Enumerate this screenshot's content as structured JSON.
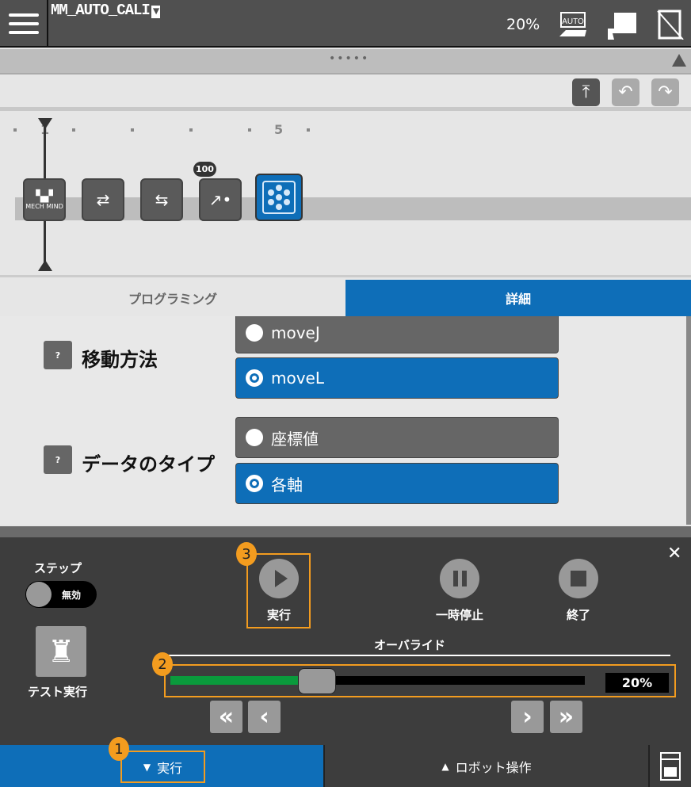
{
  "header": {
    "program_name": "MM_AUTO_CALI",
    "dropdown_glyph": "▼",
    "override": "20%",
    "icons": [
      "menu-icon",
      "auto-mode-icon",
      "robot-teach-icon",
      "tablet-disabled-icon"
    ]
  },
  "bar": {
    "handle": "•••••",
    "collapse": "▲"
  },
  "toolbar": {
    "icons": [
      "upload-icon",
      "undo-icon",
      "redo-icon"
    ]
  },
  "timeline": {
    "ruler_labels": {
      "first": "1",
      "fifth": "5"
    },
    "nodes": [
      {
        "name": "mech-mind-node",
        "label": "MECH MIND"
      },
      {
        "name": "coordinate-swap-node"
      },
      {
        "name": "tool-swap-node"
      },
      {
        "name": "move-node",
        "badge": "100"
      },
      {
        "name": "pattern-node",
        "selected": true
      }
    ]
  },
  "tabs": {
    "programming": "プログラミング",
    "details": "詳細"
  },
  "detail": {
    "help": "?",
    "move_method": {
      "label": "移動方法",
      "options": [
        "moveJ",
        "moveL"
      ],
      "selected": "moveL"
    },
    "data_type": {
      "label": "データのタイプ",
      "options": [
        "座標値",
        "各軸"
      ],
      "selected": "各軸"
    }
  },
  "panel": {
    "step_label": "ステップ",
    "step_toggle": "無効",
    "test_run": "テスト実行",
    "run": "実行",
    "pause": "一時停止",
    "stop": "終了",
    "override_label": "オーバライド",
    "override_value": "20%",
    "override_percent": 20,
    "badges": [
      "1",
      "2",
      "3"
    ],
    "nav": [
      "«",
      "‹",
      "›",
      "»"
    ]
  },
  "bottombar": {
    "run_tab": "実行",
    "run_arrow": "▼",
    "robot_tab": "ロボット操作",
    "robot_arrow": "▲"
  },
  "colors": {
    "accent": "#0e6eb8",
    "highlight": "#f39c1f",
    "slider_fill": "#0a9a3c"
  }
}
